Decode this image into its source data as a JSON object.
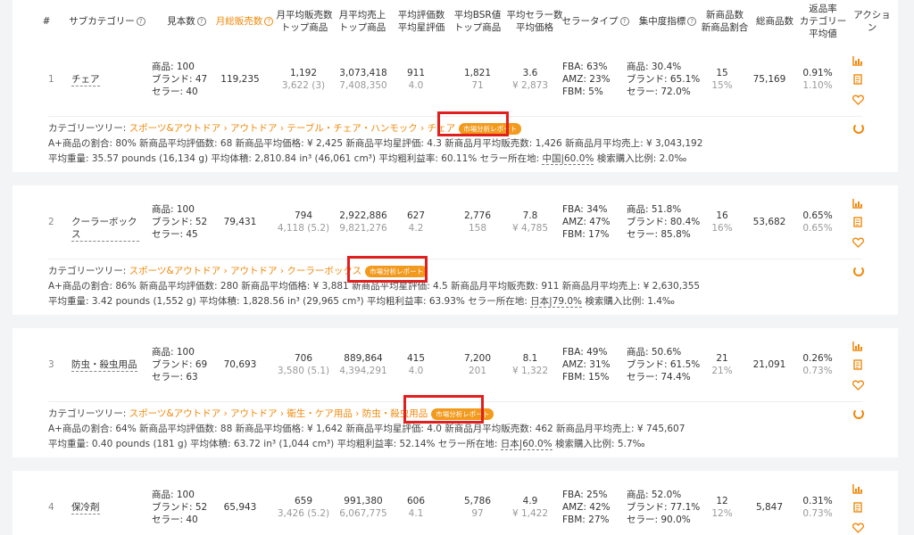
{
  "header": {
    "idx": "#",
    "subcat": "サブカテゴリー",
    "results": "見本数",
    "monthly_sales": "月総販売数",
    "avg_sales_top": [
      "月平均販売数",
      "トップ商品"
    ],
    "avg_revenue_top": [
      "月平均売上",
      "トップ商品"
    ],
    "avg_reviews": [
      "平均評価数",
      "平均星評価"
    ],
    "avg_bsr": [
      "平均BSR値",
      "トップ商品"
    ],
    "avg_sellers": [
      "平均セラー数",
      "平均価格"
    ],
    "seller_type": "セラータイプ",
    "concentration": "集中度指標",
    "new_products": [
      "新商品数",
      "新商品割合"
    ],
    "total_products": "総商品数",
    "return_rate": [
      "返品率",
      "カテゴリー",
      "平均値"
    ],
    "action": "アクション"
  },
  "rows": [
    {
      "idx": "1",
      "name": "チェア",
      "samples": [
        "商品: 100",
        "ブランド: 47",
        "セラー: 40"
      ],
      "monthly_sales": "119,235",
      "avg_sales": "1,192",
      "avg_sales_top": "3,622 (3)",
      "avg_revenue": "3,073,418",
      "avg_revenue_top": "7,408,350",
      "reviews": "911",
      "rating": "4.0",
      "bsr": "1,821",
      "bsr_top": "71",
      "sellers": "3.6",
      "price": "¥ 2,873",
      "seller_type": [
        "FBA: 63%",
        "AMZ: 23%",
        "FBM: 5%"
      ],
      "concentration": [
        "商品: 30.4%",
        "ブランド: 65.1%",
        "セラー: 72.0%"
      ],
      "new_count": "15",
      "new_ratio": "15%",
      "total": "75,169",
      "return_rate": "0.91%",
      "return_avg": "1.10%",
      "tree_label": "カテゴリーツリー:",
      "tree": [
        "スポーツ&アウトドア",
        "アウトドア",
        "テーブル・チェア・ハンモック",
        "チェア"
      ],
      "badge": "市場分析レポート",
      "stats1": "A+商品の割合: 80%   新商品平均評価数: 68   新商品平均価格: ¥ 2,425   新商品平均星評価: 4.3   新商品月平均販売数: 1,426   新商品月平均売上: ¥ 3,043,192",
      "stats2a": "平均重量: 35.57 pounds (16,134 g)   平均体積: 2,810.84 in³ (46,061 cm³)   平均粗利益率: 60.11%   セラー所在地:",
      "stats2b": "中国|60.0%",
      "stats2c": "   検索購入比例: 2.0‰"
    },
    {
      "idx": "2",
      "name": "クーラーボックス",
      "samples": [
        "商品: 100",
        "ブランド: 52",
        "セラー: 45"
      ],
      "monthly_sales": "79,431",
      "avg_sales": "794",
      "avg_sales_top": "4,118 (5.2)",
      "avg_revenue": "2,922,886",
      "avg_revenue_top": "9,821,276",
      "reviews": "627",
      "rating": "4.2",
      "bsr": "2,776",
      "bsr_top": "158",
      "sellers": "7.8",
      "price": "¥ 4,785",
      "seller_type": [
        "FBA: 34%",
        "AMZ: 47%",
        "FBM: 17%"
      ],
      "concentration": [
        "商品: 51.8%",
        "ブランド: 80.4%",
        "セラー: 85.8%"
      ],
      "new_count": "16",
      "new_ratio": "16%",
      "total": "53,682",
      "return_rate": "0.65%",
      "return_avg": "0.65%",
      "tree_label": "カテゴリーツリー:",
      "tree": [
        "スポーツ&アウトドア",
        "アウトドア",
        "クーラーボックス"
      ],
      "badge": "市場分析レポート",
      "stats1": "A+商品の割合: 86%   新商品平均評価数: 280   新商品平均価格: ¥ 3,881   新商品平均星評価: 4.5   新商品月平均販売数: 911   新商品月平均売上: ¥ 2,630,355",
      "stats2a": "平均重量: 3.42 pounds (1,552 g)   平均体積: 1,828.56 in³ (29,965 cm³)   平均粗利益率: 63.93%   セラー所在地:",
      "stats2b": "日本|79.0%",
      "stats2c": "   検索購入比例: 1.4‰"
    },
    {
      "idx": "3",
      "name": "防虫・殺虫用品",
      "samples": [
        "商品: 100",
        "ブランド: 69",
        "セラー: 63"
      ],
      "monthly_sales": "70,693",
      "avg_sales": "706",
      "avg_sales_top": "3,580 (5.1)",
      "avg_revenue": "889,864",
      "avg_revenue_top": "4,394,291",
      "reviews": "415",
      "rating": "4.0",
      "bsr": "7,200",
      "bsr_top": "201",
      "sellers": "8.1",
      "price": "¥ 1,322",
      "seller_type": [
        "FBA: 49%",
        "AMZ: 31%",
        "FBM: 15%"
      ],
      "concentration": [
        "商品: 50.6%",
        "ブランド: 61.5%",
        "セラー: 74.4%"
      ],
      "new_count": "21",
      "new_ratio": "21%",
      "total": "21,091",
      "return_rate": "0.26%",
      "return_avg": "0.73%",
      "tree_label": "カテゴリーツリー:",
      "tree": [
        "スポーツ&アウトドア",
        "アウトドア",
        "衛生・ケア用品",
        "防虫・殺虫用品"
      ],
      "badge": "市場分析レポート",
      "stats1": "A+商品の割合: 64%   新商品平均評価数: 88   新商品平均価格: ¥ 1,642   新商品平均星評価: 4.0   新商品月平均販売数: 462   新商品月平均売上: ¥ 745,607",
      "stats2a": "平均重量: 0.40 pounds (181 g)   平均体積: 63.72 in³ (1,044 cm³)   平均粗利益率: 52.14%   セラー所在地:",
      "stats2b": "日本|60.0%",
      "stats2c": "   検索購入比例: 5.7‰"
    },
    {
      "idx": "4",
      "name": "保冷剤",
      "samples": [
        "商品: 100",
        "ブランド: 52",
        "セラー: 40"
      ],
      "monthly_sales": "65,943",
      "avg_sales": "659",
      "avg_sales_top": "3,426 (5.2)",
      "avg_revenue": "991,380",
      "avg_revenue_top": "6,067,775",
      "reviews": "606",
      "rating": "4.1",
      "bsr": "5,786",
      "bsr_top": "97",
      "sellers": "4.9",
      "price": "¥ 1,422",
      "seller_type": [
        "FBA: 25%",
        "AMZ: 42%",
        "FBM: 27%"
      ],
      "concentration": [
        "商品: 52.0%",
        "ブランド: 77.1%",
        "セラー: 90.0%"
      ],
      "new_count": "12",
      "new_ratio": "12%",
      "total": "5,847",
      "return_rate": "0.31%",
      "return_avg": "0.73%"
    }
  ],
  "colors": {
    "accent": "#f0880a",
    "highlight": "#e0201e",
    "badge": "#f29a1e"
  },
  "icons": {
    "chart": "bar-chart-icon",
    "doc": "document-icon",
    "fav": "heart-icon",
    "refresh": "refresh-icon"
  }
}
